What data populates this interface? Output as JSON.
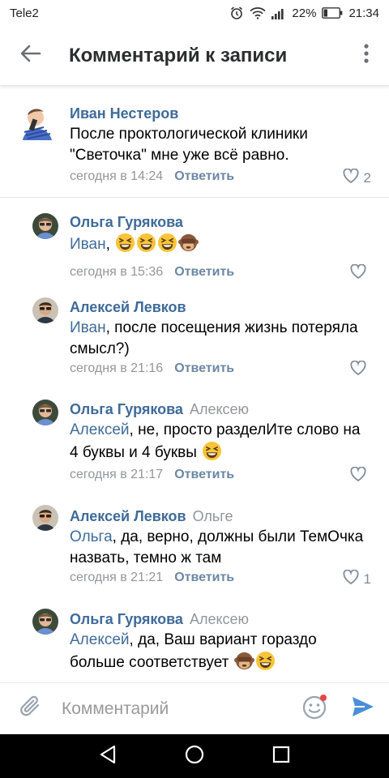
{
  "status_bar": {
    "carrier": "Tele2",
    "battery_percent": "22%",
    "time": "21:34"
  },
  "header": {
    "title": "Комментарий к записи",
    "back_icon": "arrow-left-icon",
    "menu_icon": "more-vertical-icon"
  },
  "comments": [
    {
      "author": "Иван Нестеров",
      "reply_to": "",
      "mention": "",
      "text": "После проктологической клиники \"Светочка\" мне уже всё равно.",
      "emoji": [],
      "time": "сегодня в 14:24",
      "reply_label": "Ответить",
      "likes": "2"
    },
    {
      "author": "Ольга Гурякова",
      "reply_to": "",
      "mention": "Иван",
      "text": ",",
      "emoji": [
        "grinning-squinting-face",
        "grinning-squinting-face",
        "grinning-squinting-face",
        "see-no-evil-monkey"
      ],
      "time": "сегодня в 15:36",
      "reply_label": "Ответить",
      "likes": ""
    },
    {
      "author": "Алексей Левков",
      "reply_to": "",
      "mention": "Иван",
      "text": ", после посещения жизнь потеряла смысл?)",
      "emoji": [],
      "time": "сегодня в 21:16",
      "reply_label": "Ответить",
      "likes": ""
    },
    {
      "author": "Ольга Гурякова",
      "reply_to": "Алексею",
      "mention": "Алексей",
      "text": ", не, просто разделИте слово на 4 буквы и 4 буквы",
      "emoji": [
        "grinning-squinting-face"
      ],
      "time": "сегодня в 21:17",
      "reply_label": "Ответить",
      "likes": ""
    },
    {
      "author": "Алексей Левков",
      "reply_to": "Ольге",
      "mention": "Ольга",
      "text": ", да, верно, должны были ТемОчка назвать, темно ж там",
      "emoji": [],
      "time": "сегодня в 21:21",
      "reply_label": "Ответить",
      "likes": "1"
    },
    {
      "author": "Ольга Гурякова",
      "reply_to": "Алексею",
      "mention": "Алексей",
      "text": ", да, Ваш вариант гораздо больше соответствует",
      "emoji": [
        "see-no-evil-monkey",
        "grinning-squinting-face"
      ],
      "time": "",
      "reply_label": "",
      "likes": ""
    }
  ],
  "composer": {
    "placeholder": "Комментарий"
  },
  "colors": {
    "link_blue": "#3f6b99",
    "meta_gray": "#939699",
    "send_blue": "#4a8fd7"
  }
}
